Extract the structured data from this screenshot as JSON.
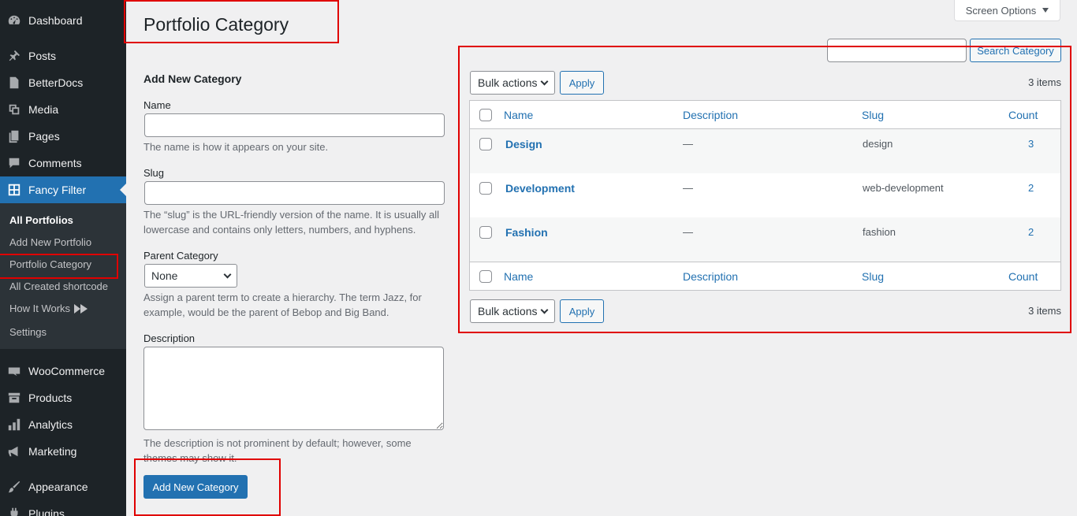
{
  "sidebar": {
    "items": [
      {
        "label": "Dashboard",
        "icon": "dashboard-icon"
      },
      {
        "label": "Posts",
        "icon": "pin-icon"
      },
      {
        "label": "BetterDocs",
        "icon": "docs-icon"
      },
      {
        "label": "Media",
        "icon": "media-icon"
      },
      {
        "label": "Pages",
        "icon": "pages-icon"
      },
      {
        "label": "Comments",
        "icon": "comment-icon"
      },
      {
        "label": "Fancy Filter",
        "icon": "grid-icon"
      },
      {
        "label": "WooCommerce",
        "icon": "woo-icon"
      },
      {
        "label": "Products",
        "icon": "archive-icon"
      },
      {
        "label": "Analytics",
        "icon": "bar-chart-icon"
      },
      {
        "label": "Marketing",
        "icon": "megaphone-icon"
      },
      {
        "label": "Appearance",
        "icon": "brush-icon"
      },
      {
        "label": "Plugins",
        "icon": "plug-icon"
      }
    ],
    "submenu": [
      {
        "label": "All Portfolios"
      },
      {
        "label": "Add New Portfolio"
      },
      {
        "label": "Portfolio Category"
      },
      {
        "label": "All Created shortcode"
      },
      {
        "label": "How It Works",
        "icon": "fast-forward-icon"
      },
      {
        "label": "Settings"
      }
    ]
  },
  "header": {
    "screen_options": "Screen Options",
    "title": "Portfolio Category"
  },
  "form": {
    "heading": "Add New Category",
    "name_label": "Name",
    "name_value": "",
    "name_help": "The name is how it appears on your site.",
    "slug_label": "Slug",
    "slug_value": "",
    "slug_help": "The “slug” is the URL-friendly version of the name. It is usually all lowercase and contains only letters, numbers, and hyphens.",
    "parent_label": "Parent Category",
    "parent_selected": "None",
    "parent_help": "Assign a parent term to create a hierarchy. The term Jazz, for example, would be the parent of Bebop and Big Band.",
    "description_label": "Description",
    "description_value": "",
    "description_help": "The description is not prominent by default; however, some themes may show it.",
    "submit_label": "Add New Category"
  },
  "search": {
    "value": "",
    "button_label": "Search Category"
  },
  "bulk": {
    "selected": "Bulk actions",
    "apply_label": "Apply",
    "count": "3 items"
  },
  "table": {
    "columns": [
      "Name",
      "Description",
      "Slug",
      "Count"
    ],
    "rows": [
      {
        "name": "Design",
        "description": "—",
        "slug": "design",
        "count": "3"
      },
      {
        "name": "Development",
        "description": "—",
        "slug": "web-development",
        "count": "2"
      },
      {
        "name": "Fashion",
        "description": "—",
        "slug": "fashion",
        "count": "2"
      }
    ]
  },
  "colors": {
    "sidebar_bg": "#1d2327",
    "accent": "#2271b1",
    "highlight": "#e00000"
  }
}
